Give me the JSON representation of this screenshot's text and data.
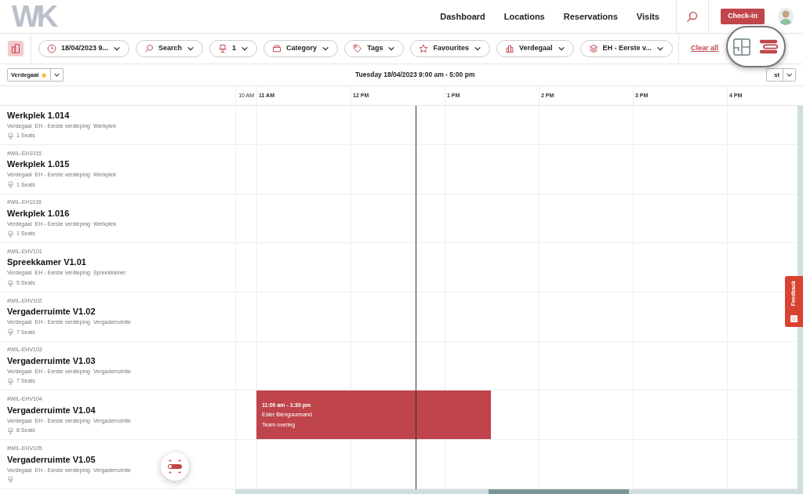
{
  "logo": "WK",
  "nav": [
    {
      "label": "Dashboard",
      "selected": false
    },
    {
      "label": "Locations",
      "selected": false
    },
    {
      "label": "Reservations",
      "selected": false
    },
    {
      "label": "Visits",
      "selected": false
    }
  ],
  "checkin_button": "Check-in",
  "filters": [
    {
      "kind": "clock",
      "label": "18/04/2023 9..."
    },
    {
      "kind": "search",
      "label": "Search"
    },
    {
      "kind": "seat",
      "label": "1"
    },
    {
      "kind": "category",
      "label": "Category"
    },
    {
      "kind": "tag",
      "label": "Tags"
    },
    {
      "kind": "star",
      "label": "Favourites"
    },
    {
      "kind": "building",
      "label": "Verdegaal"
    },
    {
      "kind": "layers",
      "label": "EH - Eerste v..."
    }
  ],
  "clear_all": "Clear all",
  "location_select": {
    "label": "Verdegaal",
    "favourite": true
  },
  "date_range": "Tuesday 18/04/2023 9:00 am - 5:00 pm",
  "right_select": {
    "label": "st"
  },
  "hours": [
    "10 AM",
    "11 AM",
    "12 PM",
    "1 PM",
    "2 PM",
    "3 PM",
    "4 PM"
  ],
  "rows": [
    {
      "name": "Werkplek 1.014",
      "tags": [
        "Verdegaal",
        "EH - Eerste verdieping",
        "Werkplek"
      ],
      "seats": "1 Seats"
    },
    {
      "id": "#WIL-EH1015",
      "name": "Werkplek 1.015",
      "tags": [
        "Verdegaal",
        "EH - Eerste verdieping",
        "Werkplek"
      ],
      "seats": "1 Seats"
    },
    {
      "id": "#WIL-EH1016",
      "name": "Werkplek 1.016",
      "tags": [
        "Verdegaal",
        "EH - Eerste verdieping",
        "Werkplek"
      ],
      "seats": "1 Seats"
    },
    {
      "id": "#WIL-EHV101",
      "name": "Spreekkamer V1.01",
      "tags": [
        "Verdegaal",
        "EH - Eerste verdieping",
        "Spreekkamer"
      ],
      "seats": "5 Seats"
    },
    {
      "id": "#WIL-EHV102",
      "name": "Vergaderruimte V1.02",
      "tags": [
        "Verdegaal",
        "EH - Eerste verdieping",
        "Vergaderruimte"
      ],
      "seats": "7 Seats"
    },
    {
      "id": "#WIL-EHV103",
      "name": "Vergaderruimte V1.03",
      "tags": [
        "Verdegaal",
        "EH - Eerste verdieping",
        "Vergaderruimte"
      ],
      "seats": "7 Seats"
    },
    {
      "id": "#WIL-EHV104",
      "name": "Vergaderruimte V1.04",
      "tags": [
        "Verdegaal",
        "EH - Eerste verdieping",
        "Vergaderruimte"
      ],
      "seats": "8 Seats",
      "booking": {
        "time": "11:00 am - 1:30 pm",
        "person": "Ester Biengourmand",
        "title": "Team overleg"
      }
    },
    {
      "id": "#WIL-EHV105",
      "name": "Vergaderruimte V1.05",
      "tags": [
        "Verdegaal",
        "EH - Eerste verdieping",
        "Vergaderruimte"
      ]
    }
  ],
  "feedback_tab": "Feedback"
}
